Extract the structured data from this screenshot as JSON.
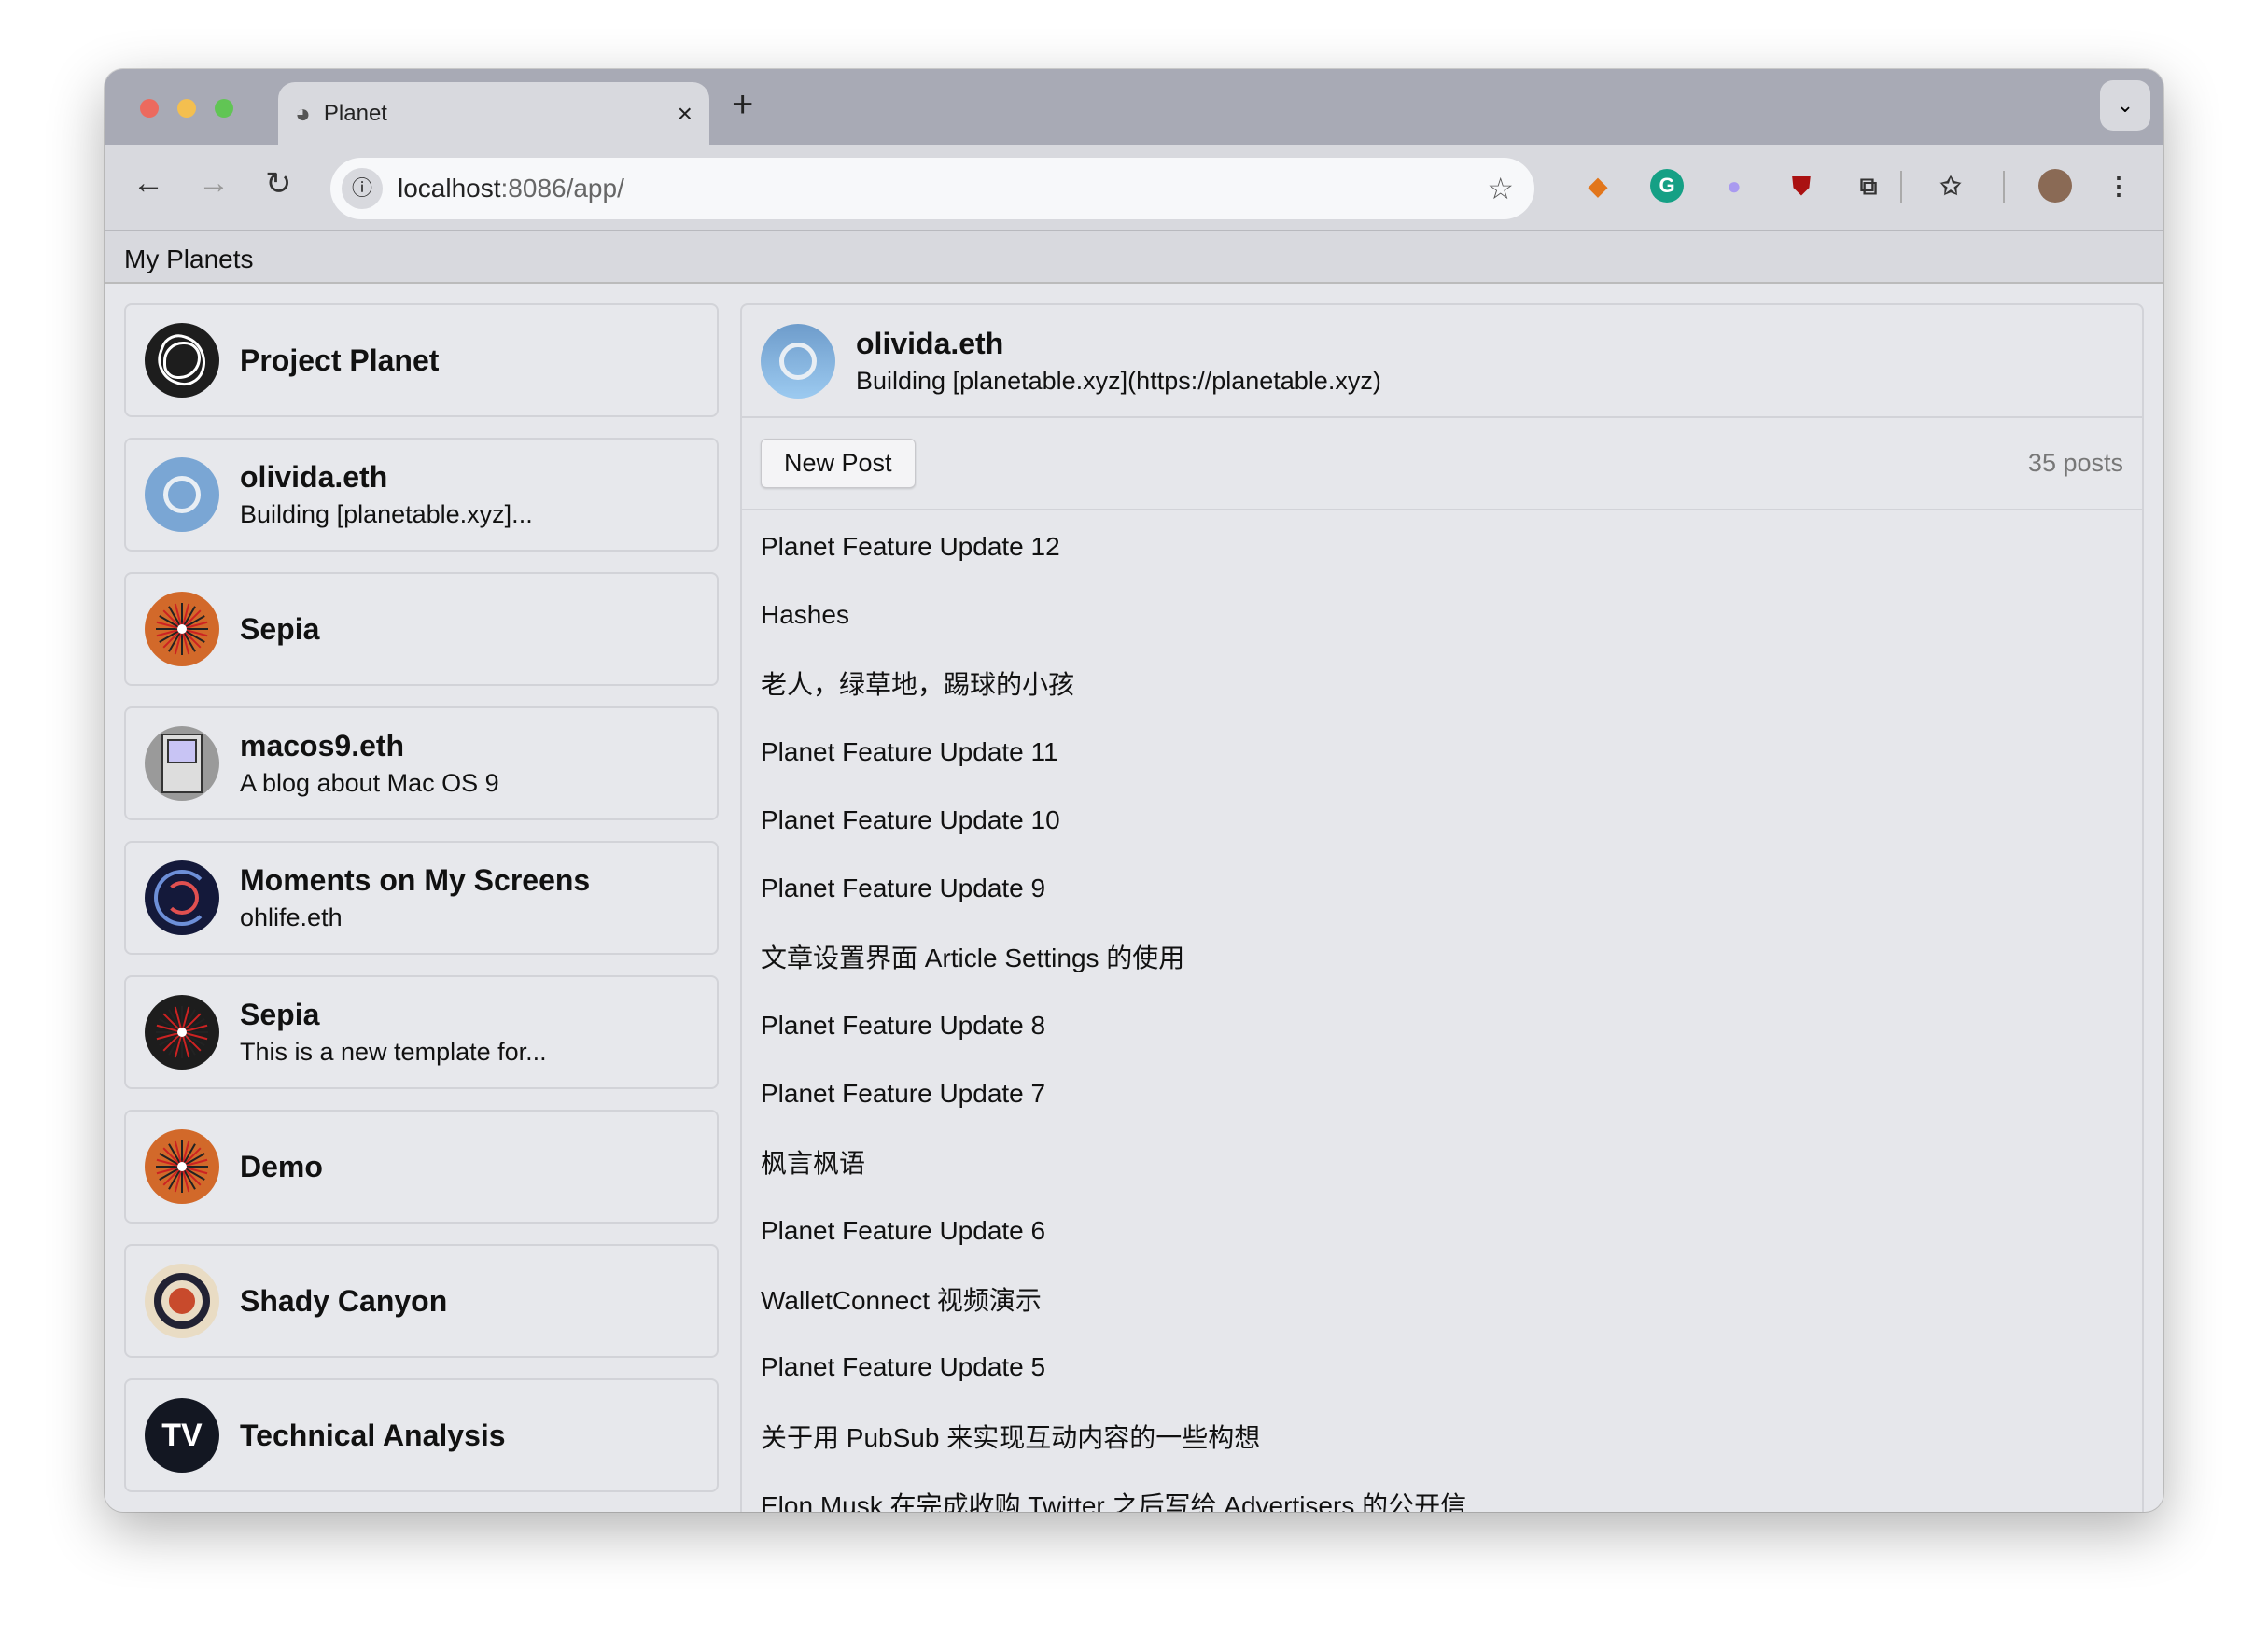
{
  "browser": {
    "tab_title": "Planet",
    "url_host": "localhost",
    "url_path": ":8086/app/",
    "close": "×",
    "new_tab": "+",
    "tab_menu": "⌄"
  },
  "app": {
    "bar_title": "My Planets"
  },
  "sidebar": {
    "items": [
      {
        "title": "Project Planet",
        "subtitle": "",
        "avatar": "project-planet",
        "color": "#1d1d1d"
      },
      {
        "title": "olivida.eth",
        "subtitle": "Building [planetable.xyz]...",
        "avatar": "ring",
        "color": "#7aa6d4"
      },
      {
        "title": "Sepia",
        "subtitle": "",
        "avatar": "burst",
        "color": "#d2692a"
      },
      {
        "title": "macos9.eth",
        "subtitle": "A blog about Mac OS 9",
        "avatar": "mac",
        "color": "#9a9a9a"
      },
      {
        "title": "Moments on My Screens",
        "subtitle": "ohlife.eth",
        "avatar": "spiral",
        "color": "#14193a"
      },
      {
        "title": "Sepia",
        "subtitle": "This is a new template for...",
        "avatar": "burst",
        "color": "#1d1d1d"
      },
      {
        "title": "Demo",
        "subtitle": "",
        "avatar": "burst",
        "color": "#d2692a"
      },
      {
        "title": "Shady Canyon",
        "subtitle": "",
        "avatar": "target",
        "color": "#e9dcc4"
      },
      {
        "title": "Technical Analysis",
        "subtitle": "",
        "avatar": "tv",
        "color": "#131722"
      }
    ]
  },
  "main": {
    "title": "olivida.eth",
    "description": "Building [planetable.xyz](https://planetable.xyz)",
    "new_post": "New Post",
    "post_count": "35 posts",
    "posts": [
      "Planet Feature Update 12",
      "Hashes",
      "老人，绿草地，踢球的小孩",
      "Planet Feature Update 11",
      "Planet Feature Update 10",
      "Planet Feature Update 9",
      "文章设置界面 Article Settings 的使用",
      "Planet Feature Update 8",
      "Planet Feature Update 7",
      "枫言枫语",
      "Planet Feature Update 6",
      "WalletConnect 视频演示",
      "Planet Feature Update 5",
      "关于用 PubSub 来实现互动内容的一些构想",
      "Elon Musk 在完成收购 Twitter 之后写给 Advertisers 的公开信"
    ]
  }
}
